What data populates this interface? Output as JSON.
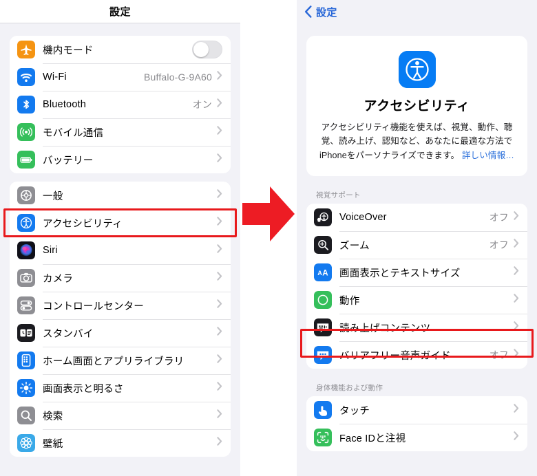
{
  "left_panel": {
    "nav_title": "設定",
    "groups": [
      {
        "name": "connectivity",
        "rows": [
          {
            "label": "機内モード",
            "icon": "airplane-icon",
            "icon_bg": "#f59412",
            "control": "toggle",
            "value": ""
          },
          {
            "label": "Wi-Fi",
            "icon": "wifi-icon",
            "icon_bg": "#137aef",
            "control": "chevron",
            "value": "Buffalo-G-9A60"
          },
          {
            "label": "Bluetooth",
            "icon": "bluetooth-icon",
            "icon_bg": "#137aef",
            "control": "chevron",
            "value": "オン"
          },
          {
            "label": "モバイル通信",
            "icon": "cellular-icon",
            "icon_bg": "#35bf5b",
            "control": "chevron",
            "value": ""
          },
          {
            "label": "バッテリー",
            "icon": "battery-icon",
            "icon_bg": "#35bf5b",
            "control": "chevron",
            "value": ""
          }
        ]
      },
      {
        "name": "system",
        "rows": [
          {
            "label": "一般",
            "icon": "gear-icon",
            "icon_bg": "#8e8e93",
            "control": "chevron",
            "value": ""
          },
          {
            "label": "アクセシビリティ",
            "icon": "accessibility-icon",
            "icon_bg": "#137aef",
            "control": "chevron",
            "value": "",
            "highlighted": true
          },
          {
            "label": "Siri",
            "icon": "siri-icon",
            "icon_bg": "#1b1b20",
            "control": "chevron",
            "value": ""
          },
          {
            "label": "カメラ",
            "icon": "camera-icon",
            "icon_bg": "#8e8e93",
            "control": "chevron",
            "value": ""
          },
          {
            "label": "コントロールセンター",
            "icon": "control-center-icon",
            "icon_bg": "#8e8e93",
            "control": "chevron",
            "value": ""
          },
          {
            "label": "スタンバイ",
            "icon": "standby-icon",
            "icon_bg": "#1b1b20",
            "control": "chevron",
            "value": ""
          },
          {
            "label": "ホーム画面とアプリライブラリ",
            "icon": "home-screen-icon",
            "icon_bg": "#137aef",
            "control": "chevron",
            "value": ""
          },
          {
            "label": "画面表示と明るさ",
            "icon": "brightness-icon",
            "icon_bg": "#137aef",
            "control": "chevron",
            "value": ""
          },
          {
            "label": "検索",
            "icon": "search-icon",
            "icon_bg": "#8e8e93",
            "control": "chevron",
            "value": ""
          },
          {
            "label": "壁紙",
            "icon": "wallpaper-icon",
            "icon_bg": "#3aa9e8",
            "control": "chevron",
            "value": ""
          }
        ]
      }
    ]
  },
  "right_panel": {
    "back_label": "設定",
    "hero": {
      "icon": "accessibility-icon",
      "title": "アクセシビリティ",
      "description": "アクセシビリティ機能を使えば、視覚、動作、聴覚、読み上げ、認知など、あなたに最適な方法でiPhoneをパーソナライズできます。",
      "link_label": "詳しい情報…"
    },
    "sections": [
      {
        "header": "視覚サポート",
        "rows": [
          {
            "label": "VoiceOver",
            "icon": "voiceover-icon",
            "icon_bg": "#1b1b20",
            "value": "オフ"
          },
          {
            "label": "ズーム",
            "icon": "zoom-icon",
            "icon_bg": "#1b1b20",
            "value": "オフ"
          },
          {
            "label": "画面表示とテキストサイズ",
            "icon": "text-size-icon",
            "icon_bg": "#137aef",
            "value": ""
          },
          {
            "label": "動作",
            "icon": "motion-icon",
            "icon_bg": "#35bf5b",
            "value": ""
          },
          {
            "label": "読み上げコンテンツ",
            "icon": "spoken-content-icon",
            "icon_bg": "#1b1b20",
            "value": ""
          },
          {
            "label": "バリアフリー音声ガイド",
            "icon": "audio-descriptions-icon",
            "icon_bg": "#137aef",
            "value": "オフ"
          }
        ]
      },
      {
        "header": "身体機能および動作",
        "rows": [
          {
            "label": "タッチ",
            "icon": "touch-icon",
            "icon_bg": "#137aef",
            "value": "",
            "highlighted": true
          },
          {
            "label": "Face IDと注視",
            "icon": "face-id-icon",
            "icon_bg": "#35bf5b",
            "value": ""
          }
        ]
      }
    ]
  },
  "annotations": {
    "arrow": {
      "name": "red-right-arrow",
      "color": "#ed1c24"
    },
    "highlight_color": "#e8191c"
  }
}
